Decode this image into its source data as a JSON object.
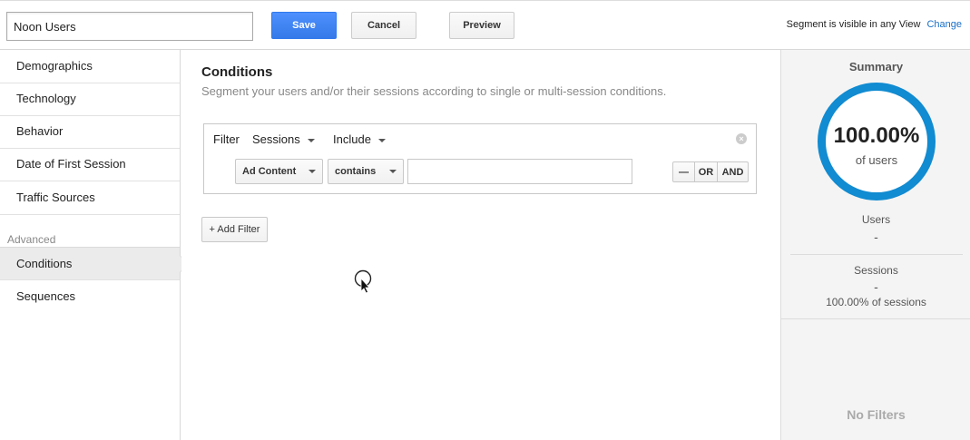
{
  "header": {
    "segment_name": "Noon Users",
    "save_label": "Save",
    "cancel_label": "Cancel",
    "preview_label": "Preview",
    "visibility_text": "Segment is visible in any View",
    "change_link": "Change"
  },
  "sidebar": {
    "items": [
      {
        "label": "Demographics"
      },
      {
        "label": "Technology"
      },
      {
        "label": "Behavior"
      },
      {
        "label": "Date of First Session"
      },
      {
        "label": "Traffic Sources"
      }
    ],
    "advanced_heading": "Advanced",
    "advanced_items": [
      {
        "label": "Conditions",
        "active": true
      },
      {
        "label": "Sequences"
      }
    ]
  },
  "main": {
    "title": "Conditions",
    "subtitle": "Segment your users and/or their sessions according to single or multi-session conditions.",
    "filter": {
      "label": "Filter",
      "scope": "Sessions",
      "mode": "Include",
      "dimension": "Ad Content",
      "operator": "contains",
      "value": "",
      "logic": {
        "remove": "—",
        "or": "OR",
        "and": "AND"
      }
    },
    "add_filter_label": "+ Add Filter"
  },
  "summary": {
    "title": "Summary",
    "percent": "100.00%",
    "percent_label": "of users",
    "users_label": "Users",
    "users_value": "-",
    "sessions_label": "Sessions",
    "sessions_value": "-",
    "sessions_pct": "100.00% of sessions",
    "no_filters": "No Filters"
  },
  "colors": {
    "accent": "#118bd1",
    "save_button": "#4d90fe",
    "link": "#1a6fc7"
  }
}
